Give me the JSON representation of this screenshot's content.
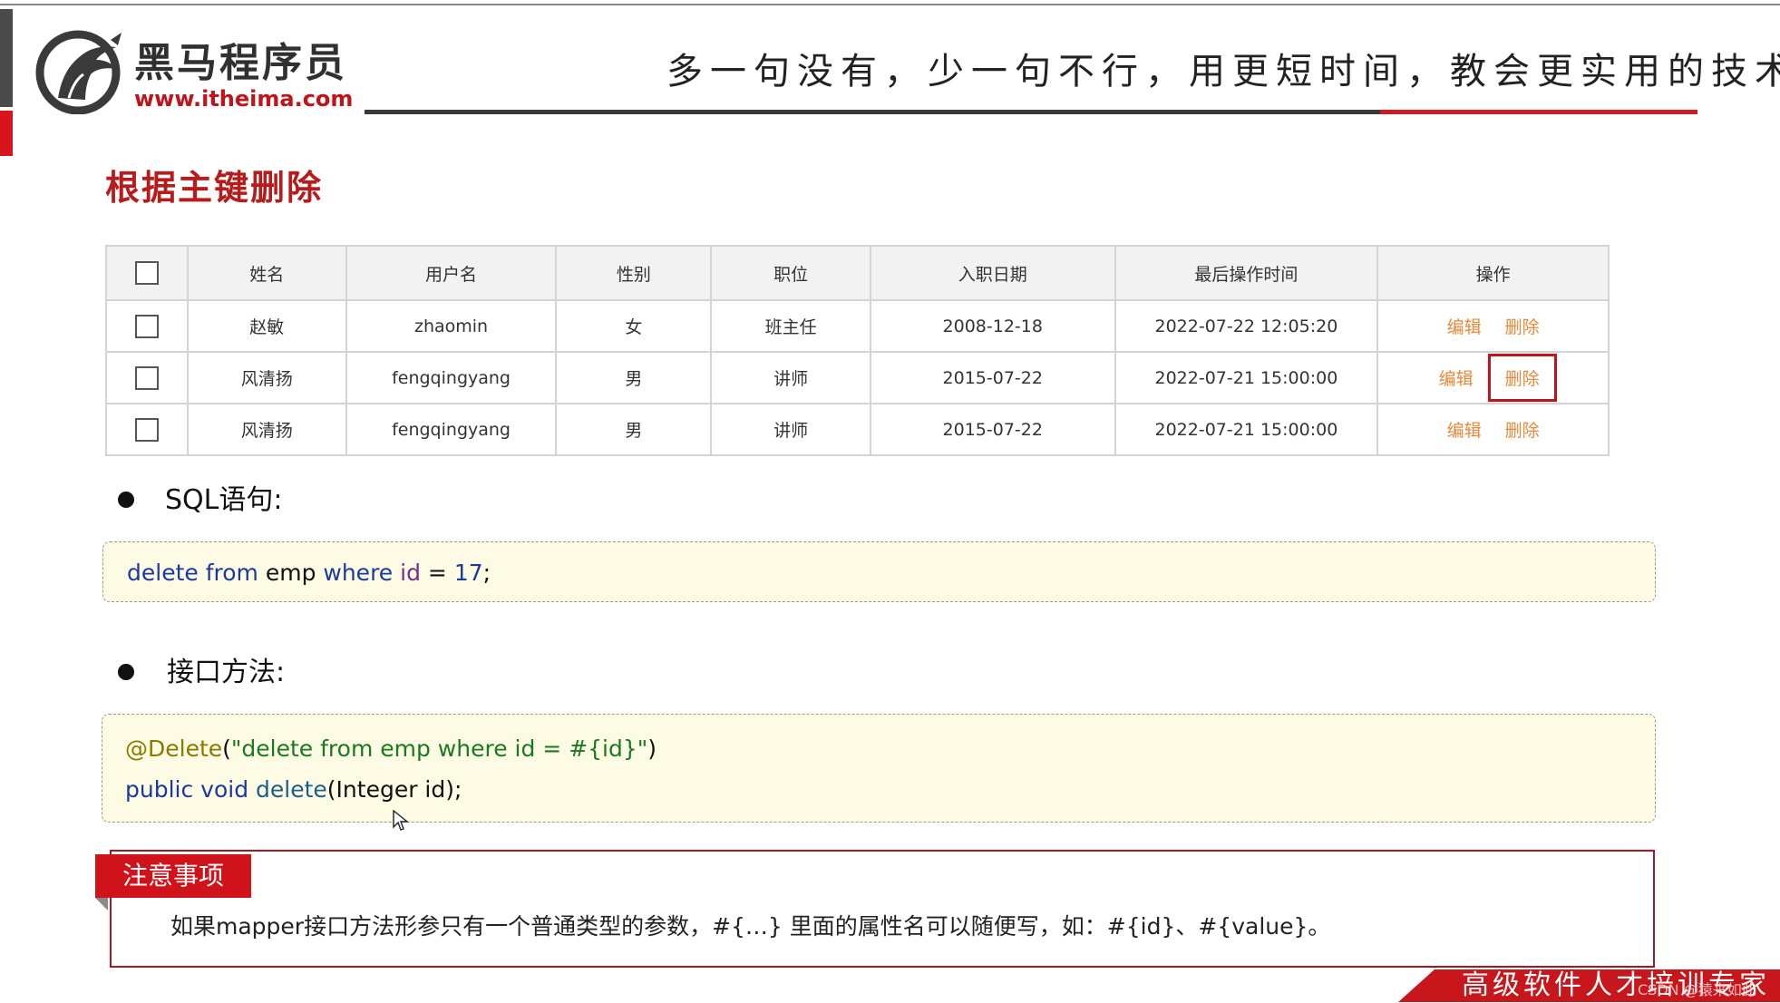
{
  "brand": {
    "name": "黑马程序员",
    "url": "www.itheima.com",
    "slogan": "多一句没有，少一句不行，用更短时间，教会更实用的技术！"
  },
  "page_title": "根据主键删除",
  "table": {
    "headers": [
      "姓名",
      "用户名",
      "性别",
      "职位",
      "入职日期",
      "最后操作时间",
      "操作"
    ],
    "rows": [
      {
        "name": "赵敏",
        "username": "zhaomin",
        "gender": "女",
        "position": "班主任",
        "entry_date": "2008-12-18",
        "last_op": "2022-07-22 12:05:20",
        "edit": "编辑",
        "delete": "删除"
      },
      {
        "name": "风清扬",
        "username": "fengqingyang",
        "gender": "男",
        "position": "讲师",
        "entry_date": "2015-07-22",
        "last_op": "2022-07-21 15:00:00",
        "edit": "编辑",
        "delete": "删除"
      },
      {
        "name": "风清扬",
        "username": "fengqingyang",
        "gender": "男",
        "position": "讲师",
        "entry_date": "2015-07-22",
        "last_op": "2022-07-21 15:00:00",
        "edit": "编辑",
        "delete": "删除"
      }
    ]
  },
  "sql_section": {
    "title": "SQL语句:",
    "code": {
      "kw1": "delete from",
      "t1": " emp ",
      "kw2": "where",
      "sp": " ",
      "id": "id",
      "eq": " = ",
      "num": "17",
      "end": ";"
    }
  },
  "method_section": {
    "title": "接口方法:",
    "line1": {
      "anno": "@Delete",
      "open": "(",
      "str": "\"delete from emp where id = #{id}\"",
      "close": ")"
    },
    "line2": {
      "kw": "public void",
      "sp": " ",
      "method": "delete",
      "params": "(Integer id);"
    }
  },
  "note": {
    "tag": "注意事项",
    "text": "如果mapper接口方法形参只有一个普通类型的参数，#{…} 里面的属性名可以随便写，如：#{id}、#{value}。"
  },
  "footer": {
    "text": "高级软件人才培训专家",
    "watermark": "CSDN @猿来如此"
  },
  "colors": {
    "brand_red": "#c0141a",
    "action_orange": "#e8893a",
    "code_bg": "#fdfbe3",
    "keyword_blue": "#1c3a9e"
  }
}
